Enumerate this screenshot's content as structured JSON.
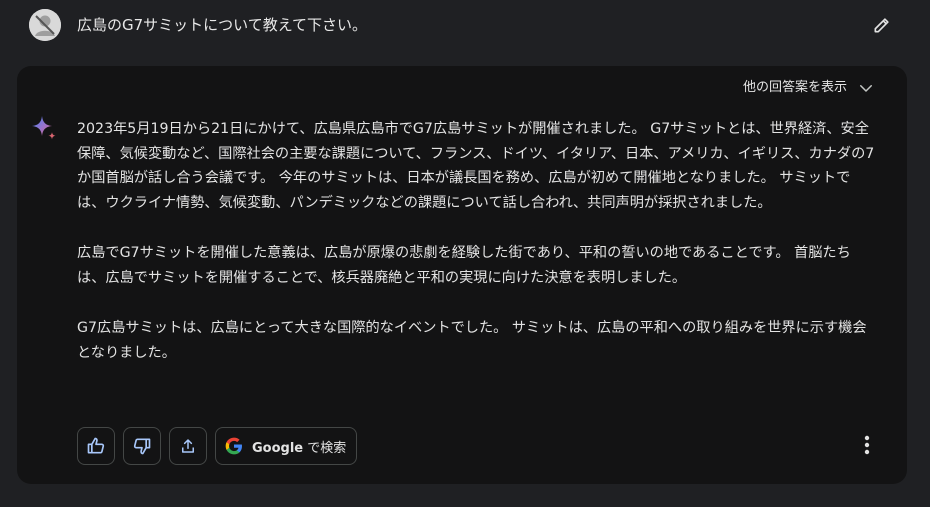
{
  "user_prompt": {
    "text": "広島のG7サミットについて教えて下さい。"
  },
  "response": {
    "other_drafts_label": "他の回答案を表示",
    "paragraphs": [
      "2023年5月19日から21日にかけて、広島県広島市でG7広島サミットが開催されました。 G7サミットとは、世界経済、安全保障、気候変動など、国際社会の主要な課題について、フランス、ドイツ、イタリア、日本、アメリカ、イギリス、カナダの7か国首脳が話し合う会議です。 今年のサミットは、日本が議長国を務め、広島が初めて開催地となりました。 サミットでは、ウクライナ情勢、気候変動、パンデミックなどの課題について話し合われ、共同声明が採択されました。",
      "広島でG7サミットを開催した意義は、広島が原爆の悲劇を経験した街であり、平和の誓いの地であることです。 首脳たちは、広島でサミットを開催することで、核兵器廃絶と平和の実現に向けた決意を表明しました。",
      "G7広島サミットは、広島にとって大きな国際的なイベントでした。 サミットは、広島の平和への取り組みを世界に示す機会となりました。"
    ]
  },
  "actions": {
    "google_label_bold": "Google",
    "google_label_rest": " で検索"
  },
  "icons": {
    "avatar": "user-avatar",
    "edit": "pencil-icon",
    "chevron": "chevron-down-icon",
    "spark": "sparkle-icon",
    "thumbs_up": "thumbs-up-icon",
    "thumbs_down": "thumbs-down-icon",
    "share": "share-icon",
    "google": "google-icon",
    "more": "more-vert-icon"
  },
  "colors": {
    "background": "#1f2023",
    "card": "#131314",
    "text": "#e3e3e3",
    "border": "#444746",
    "spark_blue": "#4285f4",
    "spark_red": "#d96570"
  }
}
